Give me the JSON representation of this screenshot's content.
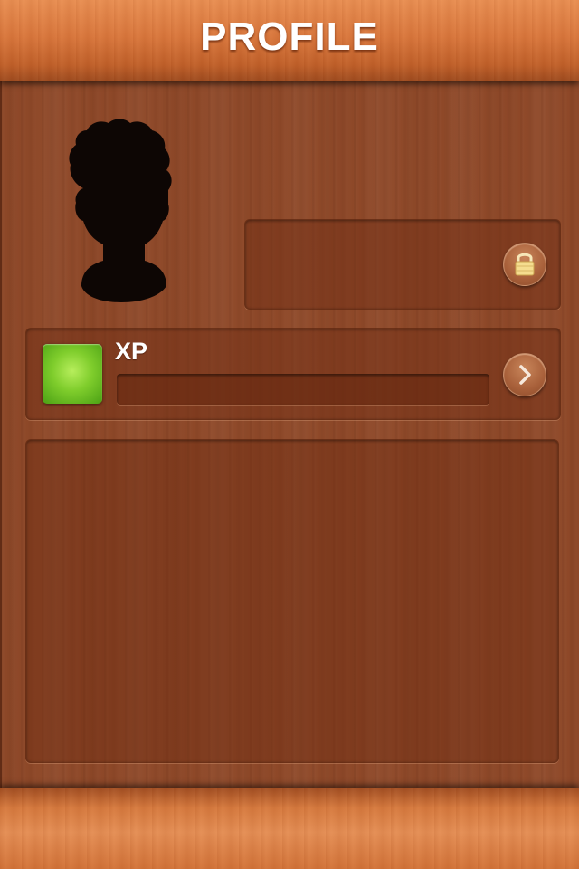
{
  "header": {
    "title": "PROFILE"
  },
  "xp": {
    "label": "XP",
    "progress": 0.0
  },
  "icons": {
    "avatar": "user-silhouette-icon",
    "lock": "lock-icon",
    "xp_badge": "xp-badge-icon",
    "arrow": "chevron-right-icon"
  },
  "colors": {
    "header_wood": "#d9773d",
    "body_wood": "#8e4828",
    "xp_badge": "#7fcd2c",
    "title_text": "#ffffff"
  }
}
